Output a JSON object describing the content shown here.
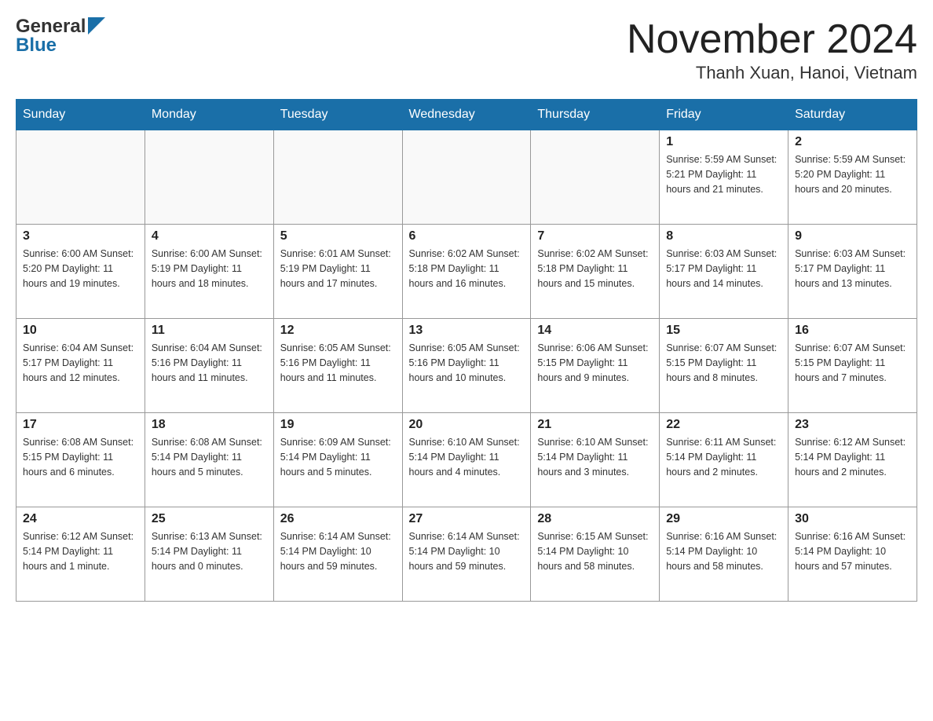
{
  "header": {
    "logo_general": "General",
    "logo_blue": "Blue",
    "month_title": "November 2024",
    "location": "Thanh Xuan, Hanoi, Vietnam"
  },
  "days_of_week": [
    "Sunday",
    "Monday",
    "Tuesday",
    "Wednesday",
    "Thursday",
    "Friday",
    "Saturday"
  ],
  "weeks": [
    {
      "days": [
        {
          "number": "",
          "info": ""
        },
        {
          "number": "",
          "info": ""
        },
        {
          "number": "",
          "info": ""
        },
        {
          "number": "",
          "info": ""
        },
        {
          "number": "",
          "info": ""
        },
        {
          "number": "1",
          "info": "Sunrise: 5:59 AM\nSunset: 5:21 PM\nDaylight: 11 hours and 21 minutes."
        },
        {
          "number": "2",
          "info": "Sunrise: 5:59 AM\nSunset: 5:20 PM\nDaylight: 11 hours and 20 minutes."
        }
      ]
    },
    {
      "days": [
        {
          "number": "3",
          "info": "Sunrise: 6:00 AM\nSunset: 5:20 PM\nDaylight: 11 hours and 19 minutes."
        },
        {
          "number": "4",
          "info": "Sunrise: 6:00 AM\nSunset: 5:19 PM\nDaylight: 11 hours and 18 minutes."
        },
        {
          "number": "5",
          "info": "Sunrise: 6:01 AM\nSunset: 5:19 PM\nDaylight: 11 hours and 17 minutes."
        },
        {
          "number": "6",
          "info": "Sunrise: 6:02 AM\nSunset: 5:18 PM\nDaylight: 11 hours and 16 minutes."
        },
        {
          "number": "7",
          "info": "Sunrise: 6:02 AM\nSunset: 5:18 PM\nDaylight: 11 hours and 15 minutes."
        },
        {
          "number": "8",
          "info": "Sunrise: 6:03 AM\nSunset: 5:17 PM\nDaylight: 11 hours and 14 minutes."
        },
        {
          "number": "9",
          "info": "Sunrise: 6:03 AM\nSunset: 5:17 PM\nDaylight: 11 hours and 13 minutes."
        }
      ]
    },
    {
      "days": [
        {
          "number": "10",
          "info": "Sunrise: 6:04 AM\nSunset: 5:17 PM\nDaylight: 11 hours and 12 minutes."
        },
        {
          "number": "11",
          "info": "Sunrise: 6:04 AM\nSunset: 5:16 PM\nDaylight: 11 hours and 11 minutes."
        },
        {
          "number": "12",
          "info": "Sunrise: 6:05 AM\nSunset: 5:16 PM\nDaylight: 11 hours and 11 minutes."
        },
        {
          "number": "13",
          "info": "Sunrise: 6:05 AM\nSunset: 5:16 PM\nDaylight: 11 hours and 10 minutes."
        },
        {
          "number": "14",
          "info": "Sunrise: 6:06 AM\nSunset: 5:15 PM\nDaylight: 11 hours and 9 minutes."
        },
        {
          "number": "15",
          "info": "Sunrise: 6:07 AM\nSunset: 5:15 PM\nDaylight: 11 hours and 8 minutes."
        },
        {
          "number": "16",
          "info": "Sunrise: 6:07 AM\nSunset: 5:15 PM\nDaylight: 11 hours and 7 minutes."
        }
      ]
    },
    {
      "days": [
        {
          "number": "17",
          "info": "Sunrise: 6:08 AM\nSunset: 5:15 PM\nDaylight: 11 hours and 6 minutes."
        },
        {
          "number": "18",
          "info": "Sunrise: 6:08 AM\nSunset: 5:14 PM\nDaylight: 11 hours and 5 minutes."
        },
        {
          "number": "19",
          "info": "Sunrise: 6:09 AM\nSunset: 5:14 PM\nDaylight: 11 hours and 5 minutes."
        },
        {
          "number": "20",
          "info": "Sunrise: 6:10 AM\nSunset: 5:14 PM\nDaylight: 11 hours and 4 minutes."
        },
        {
          "number": "21",
          "info": "Sunrise: 6:10 AM\nSunset: 5:14 PM\nDaylight: 11 hours and 3 minutes."
        },
        {
          "number": "22",
          "info": "Sunrise: 6:11 AM\nSunset: 5:14 PM\nDaylight: 11 hours and 2 minutes."
        },
        {
          "number": "23",
          "info": "Sunrise: 6:12 AM\nSunset: 5:14 PM\nDaylight: 11 hours and 2 minutes."
        }
      ]
    },
    {
      "days": [
        {
          "number": "24",
          "info": "Sunrise: 6:12 AM\nSunset: 5:14 PM\nDaylight: 11 hours and 1 minute."
        },
        {
          "number": "25",
          "info": "Sunrise: 6:13 AM\nSunset: 5:14 PM\nDaylight: 11 hours and 0 minutes."
        },
        {
          "number": "26",
          "info": "Sunrise: 6:14 AM\nSunset: 5:14 PM\nDaylight: 10 hours and 59 minutes."
        },
        {
          "number": "27",
          "info": "Sunrise: 6:14 AM\nSunset: 5:14 PM\nDaylight: 10 hours and 59 minutes."
        },
        {
          "number": "28",
          "info": "Sunrise: 6:15 AM\nSunset: 5:14 PM\nDaylight: 10 hours and 58 minutes."
        },
        {
          "number": "29",
          "info": "Sunrise: 6:16 AM\nSunset: 5:14 PM\nDaylight: 10 hours and 58 minutes."
        },
        {
          "number": "30",
          "info": "Sunrise: 6:16 AM\nSunset: 5:14 PM\nDaylight: 10 hours and 57 minutes."
        }
      ]
    }
  ]
}
